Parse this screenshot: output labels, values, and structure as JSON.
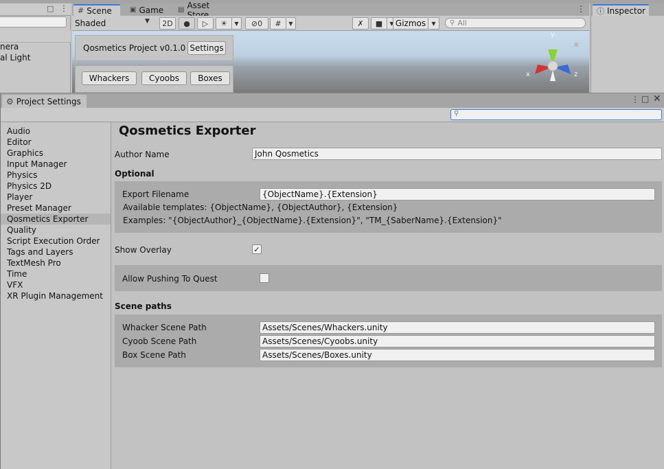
{
  "hierarchy": {
    "items": [
      "nera",
      "al Light"
    ]
  },
  "scene_tabs": [
    {
      "label": "Scene",
      "icon": "grid-icon"
    },
    {
      "label": "Game",
      "icon": "gamepad-icon"
    },
    {
      "label": "Asset Store",
      "icon": "bag-icon"
    }
  ],
  "scene_toolbar": {
    "shading": "Shaded",
    "mode_2d": "2D",
    "hidden_count": "0",
    "gizmos": "Gizmos",
    "search_placeholder": "All"
  },
  "overlay": {
    "project_title": "Qosmetics Project v0.1.0",
    "settings_button": "Settings",
    "tabs": [
      "Whackers",
      "Cyoobs",
      "Boxes"
    ]
  },
  "gizmo": {
    "y": "y",
    "x": "x",
    "z": "z"
  },
  "inspector": {
    "tab": "Inspector"
  },
  "project_settings": {
    "window_title": "Project Settings",
    "sidebar": [
      "Audio",
      "Editor",
      "Graphics",
      "Input Manager",
      "Physics",
      "Physics 2D",
      "Player",
      "Preset Manager",
      "Qosmetics Exporter",
      "Quality",
      "Script Execution Order",
      "Tags and Layers",
      "TextMesh Pro",
      "Time",
      "VFX",
      "XR Plugin Management"
    ],
    "selected": "Qosmetics Exporter"
  },
  "exporter": {
    "title": "Qosmetics Exporter",
    "author_label": "Author Name",
    "author_value": "John Qosmetics",
    "optional_header": "Optional",
    "export_label": "Export Filename",
    "export_value": "{ObjectName}.{Extension}",
    "templates_text": "Available templates: {ObjectName}, {ObjectAuthor}, {Extension}",
    "examples_text": "Examples: \"{ObjectAuthor}_{ObjectName}.{Extension}\", \"TM_{SaberName}.{Extension}\"",
    "show_overlay_label": "Show Overlay",
    "show_overlay_checked": true,
    "allow_quest_label": "Allow Pushing To Quest",
    "allow_quest_checked": false,
    "scene_paths_header": "Scene paths",
    "paths": [
      {
        "label": "Whacker Scene Path",
        "value": "Assets/Scenes/Whackers.unity"
      },
      {
        "label": "Cyoob Scene Path",
        "value": "Assets/Scenes/Cyoobs.unity"
      },
      {
        "label": "Box Scene Path",
        "value": "Assets/Scenes/Boxes.unity"
      }
    ]
  },
  "colors": {
    "selection": "#b5b5b5",
    "group_bg": "#ababab",
    "focus_blue": "#3a79d8",
    "gizmo_x": "#d03434",
    "gizmo_y": "#8ad232",
    "gizmo_z": "#3a6ad8"
  }
}
